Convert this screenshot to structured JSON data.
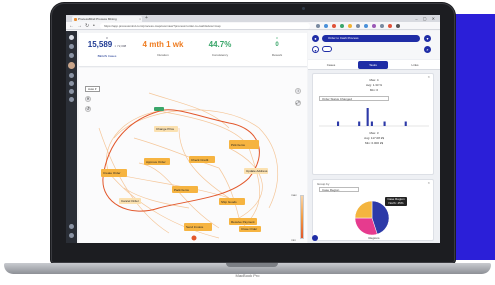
{
  "browser": {
    "tab_title": "ProcessMind Process Mining",
    "url": "https://app.processmind.com/process-map/overview?process=order-to-cash&view=map"
  },
  "metrics": [
    {
      "top": "#",
      "value": "15,589",
      "unit": "× 72,008",
      "label": "BEGIN\nCases",
      "color": "#1f3a93"
    },
    {
      "top": "",
      "value": "4 mth 1 wk",
      "unit": "",
      "label": "Duration",
      "color": "#ef7d22"
    },
    {
      "top": "",
      "value": "44.7%",
      "unit": "",
      "label": "Consistency",
      "color": "#3aa66a"
    },
    {
      "top": "0",
      "value": "0",
      "unit": "",
      "label": "Rework",
      "color": "#3aa66a"
    }
  ],
  "map": {
    "tag": "Auto ▾",
    "tools": [
      "✕",
      "↺",
      "↕",
      "⤢"
    ],
    "nodes": [
      "Create Order",
      "Approve Order",
      "Check Credit",
      "Pick Items",
      "Pack Items",
      "Ship Goods",
      "Send Invoice",
      "Receive Payment",
      "Close Order",
      "Change Price",
      "Cancel Order",
      "Update Address"
    ],
    "legend_top": "max",
    "legend_bottom": "min"
  },
  "right_panel": {
    "selected_process": "Order to Cash Process",
    "tabs": [
      "Cases",
      "Tasks",
      "Links"
    ],
    "active_tab": 1,
    "card1": {
      "line1": "Max: 4",
      "line2": "Avg: 1.33 %",
      "line3": "Min: 0",
      "select": "Order Status Changed",
      "stat1": "Max: 3",
      "stat2": "Avg: 117.08 k$",
      "stat3": "Min: 0.000 k$"
    },
    "card2": {
      "title": "Group by",
      "select": "Case Region",
      "tooltip_line1": "Case Region",
      "tooltip_line2": "North: 45%",
      "caption": "Regions"
    },
    "pie": [
      {
        "name": "North",
        "value": 45,
        "color": "#2d3aa8"
      },
      {
        "name": "West",
        "value": 30,
        "color": "#e63b8e"
      },
      {
        "name": "South",
        "value": 25,
        "color": "#f4b53f"
      }
    ],
    "sparkline": [
      0,
      0,
      0,
      0,
      1,
      0,
      0,
      0,
      0,
      1,
      0,
      4,
      1,
      0,
      0,
      1,
      0,
      0,
      0,
      0,
      1,
      0,
      0,
      0,
      0,
      0
    ]
  },
  "device_label": "MacBook Pro",
  "colors": {
    "accent": "#1f2da6",
    "node": "#f6b441",
    "edge": "#f5c79a",
    "highlight": "#e2572b",
    "blue_panel": "#2b1fd8"
  }
}
